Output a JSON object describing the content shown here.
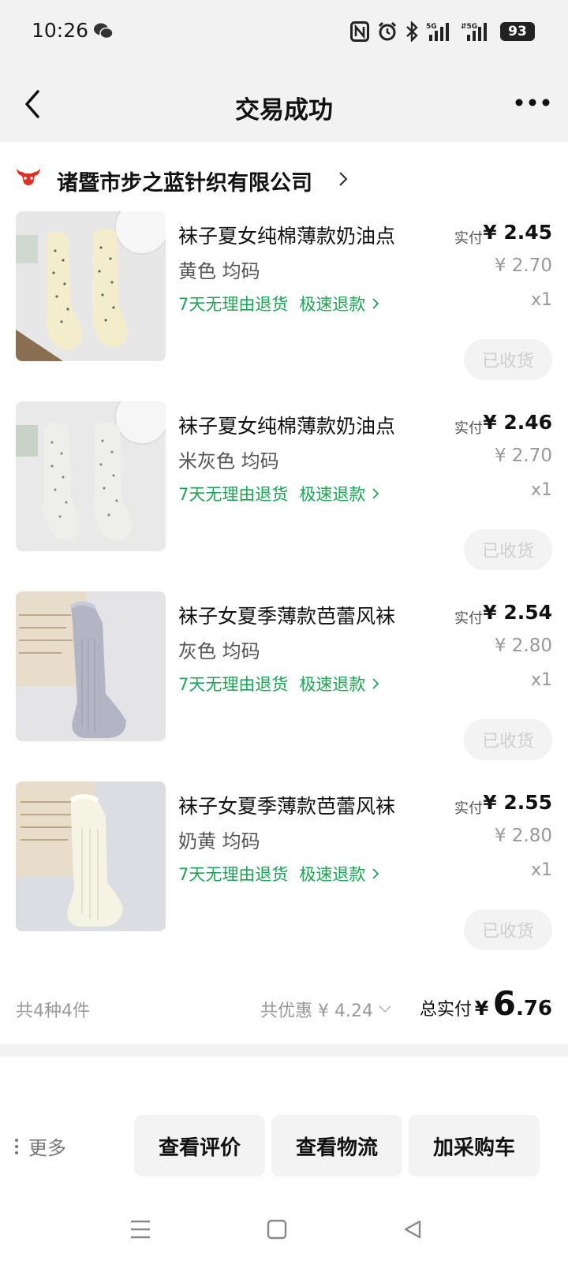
{
  "status_bar": {
    "time": "10:26",
    "battery": "93"
  },
  "nav": {
    "title": "交易成功"
  },
  "shop": {
    "name": "诸暨市步之蓝针织有限公司"
  },
  "items": [
    {
      "title": "袜子夏女纯棉薄款奶油点",
      "spec": "黄色 均码",
      "tag_return": "7天无理由退货",
      "tag_refund": "极速退款",
      "paid_label": "实付",
      "paid": "¥ 2.45",
      "original": "¥ 2.70",
      "qty": "x1",
      "status_button": "已收货"
    },
    {
      "title": "袜子夏女纯棉薄款奶油点",
      "spec": "米灰色 均码",
      "tag_return": "7天无理由退货",
      "tag_refund": "极速退款",
      "paid_label": "实付",
      "paid": "¥ 2.46",
      "original": "¥ 2.70",
      "qty": "x1",
      "status_button": "已收货"
    },
    {
      "title": "袜子女夏季薄款芭蕾风袜",
      "spec": "灰色 均码",
      "tag_return": "7天无理由退货",
      "tag_refund": "极速退款",
      "paid_label": "实付",
      "paid": "¥ 2.54",
      "original": "¥ 2.80",
      "qty": "x1",
      "status_button": "已收货"
    },
    {
      "title": "袜子女夏季薄款芭蕾风袜",
      "spec": "奶黄 均码",
      "tag_return": "7天无理由退货",
      "tag_refund": "极速退款",
      "paid_label": "实付",
      "paid": "¥ 2.55",
      "original": "¥ 2.80",
      "qty": "x1",
      "status_button": "已收货"
    }
  ],
  "summary": {
    "count": "共4种4件",
    "discount": "共优惠 ¥ 4.24",
    "total_label": "总实付",
    "total_currency": "¥",
    "total_integer": "6",
    "total_decimal": ".76"
  },
  "actions": {
    "more": "更多",
    "review": "查看评价",
    "logistics": "查看物流",
    "add_cart": "加采购车"
  },
  "colors": {
    "accent_green": "#1fa354",
    "logo_red": "#e02e24",
    "page_gray": "#f2f2f2"
  },
  "icons": [
    "wechat-icon",
    "nfc-icon",
    "alarm-icon",
    "bluetooth-icon",
    "signal-icon",
    "back-icon",
    "more-icon",
    "shop-logo-icon",
    "chevron-right-icon",
    "chevron-down-icon",
    "menu-icon",
    "home-icon",
    "back-triangle-icon"
  ]
}
